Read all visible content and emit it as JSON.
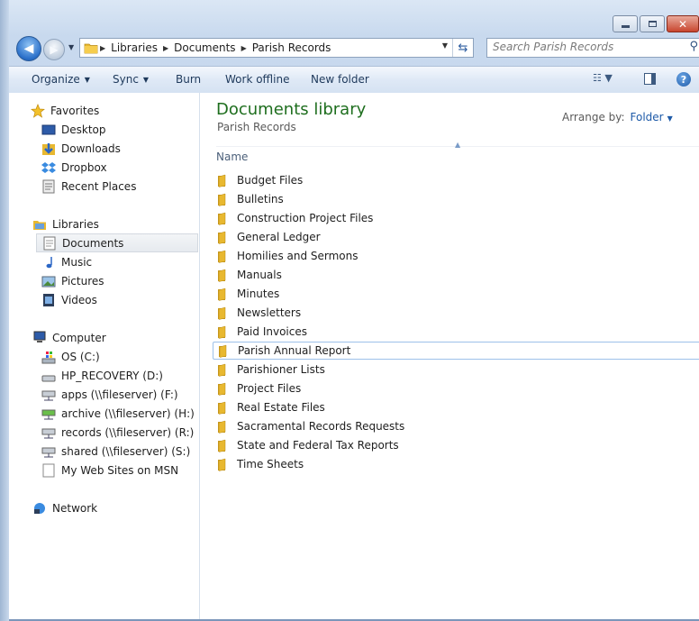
{
  "window": {
    "caption_buttons": [
      "minimize",
      "maximize",
      "close"
    ],
    "close_color": "#c8462f"
  },
  "nav": {
    "back_icon": "back-arrow-icon",
    "forward_icon": "forward-arrow-icon",
    "breadcrumb": [
      "Libraries",
      "Documents",
      "Parish Records"
    ],
    "search_placeholder": "Search Parish Records"
  },
  "command_bar": {
    "organize": "Organize",
    "sync": "Sync",
    "burn": "Burn",
    "work_offline": "Work offline",
    "new_folder": "New folder"
  },
  "sidebar": {
    "favorites": {
      "label": "Favorites",
      "items": [
        "Desktop",
        "Downloads",
        "Dropbox",
        "Recent Places"
      ]
    },
    "libraries": {
      "label": "Libraries",
      "items": [
        "Documents",
        "Music",
        "Pictures",
        "Videos"
      ],
      "selected": "Documents"
    },
    "computer": {
      "label": "Computer",
      "items": [
        "OS (C:)",
        "HP_RECOVERY (D:)",
        "apps (\\\\fileserver) (F:)",
        "archive (\\\\fileserver) (H:)",
        "records (\\\\fileserver) (R:)",
        "shared (\\\\fileserver) (S:)",
        "My Web Sites on MSN"
      ]
    },
    "network": {
      "label": "Network"
    }
  },
  "content": {
    "title": "Documents library",
    "subtitle": "Parish Records",
    "arrange_label": "Arrange by:",
    "arrange_value": "Folder",
    "column_name": "Name",
    "folders": [
      "Budget Files",
      "Bulletins",
      "Construction Project Files",
      "General Ledger",
      "Homilies and Sermons",
      "Manuals",
      "Minutes",
      "Newsletters",
      "Paid Invoices",
      "Parish Annual Report",
      "Parishioner Lists",
      "Project Files",
      "Real Estate Files",
      "Sacramental Records Requests",
      "State and Federal Tax Reports",
      "Time Sheets"
    ],
    "highlighted_folder": "Parish Annual Report",
    "title_color": "#1e6e1e",
    "folder_color": "#e8b830"
  }
}
